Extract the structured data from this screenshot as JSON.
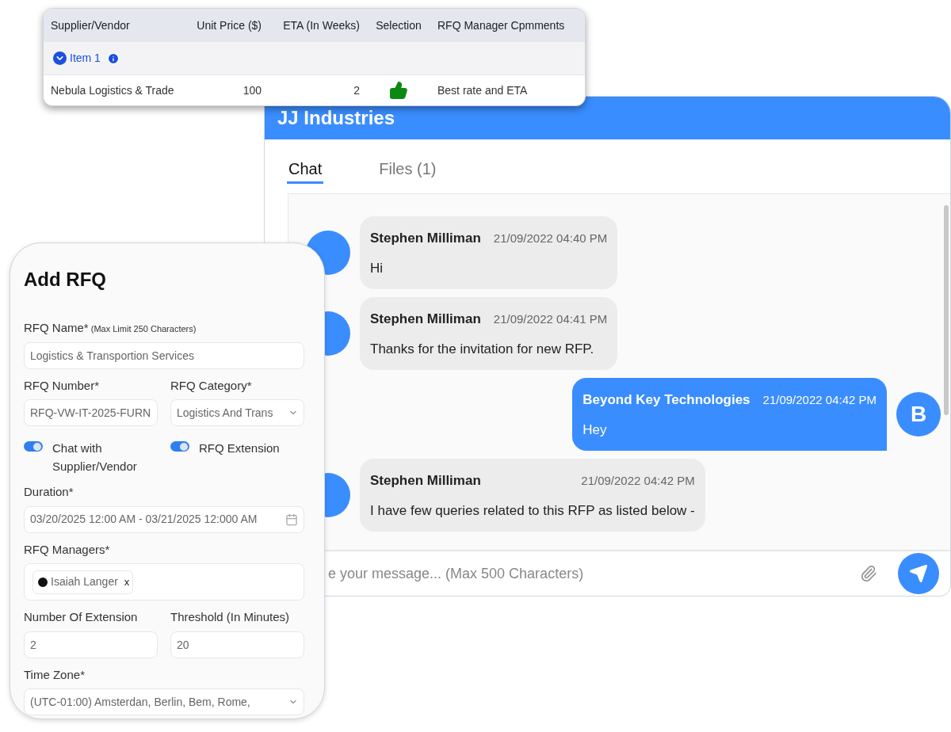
{
  "rfq_table": {
    "columns": [
      "Supplier/Vendor",
      "Unit Price ($)",
      "ETA (In Weeks)",
      "Selection",
      "RFQ Manager Cpmments"
    ],
    "groups": [
      {
        "label": "Item 1",
        "expanded": true,
        "rows": [
          {
            "supplier": "Nebula Logistics & Trade",
            "unit_price": "100",
            "eta": "2",
            "selected": true,
            "comment": "Best rate and ETA"
          }
        ]
      }
    ]
  },
  "chat": {
    "title": "JJ Industries",
    "tabs": [
      {
        "label": "Chat",
        "selected": true
      },
      {
        "label": "Files (1)",
        "selected": false
      }
    ],
    "messages": [
      {
        "sender": "Stephen Milliman",
        "time": "21/09/2022 04:40 PM",
        "text": "Hi",
        "own": false
      },
      {
        "sender": "Stephen Milliman",
        "time": "21/09/2022 04:41 PM",
        "text": "Thanks for the invitation for new RFP.",
        "own": false
      },
      {
        "sender": "Beyond Key Technologies",
        "time": "21/09/2022 04:42 PM",
        "text": "Hey",
        "avatar": "B",
        "own": true
      },
      {
        "sender": "Stephen Milliman",
        "time": "21/09/2022 04:42 PM",
        "text": "I have few queries related to this RFP as listed below -",
        "own": false
      }
    ],
    "composer": {
      "placeholder": "e your message... (Max 500 Characters)"
    }
  },
  "add_rfq": {
    "title": "Add RFQ",
    "rows": [
      [
        {
          "kind": "text",
          "label": "RFQ Name*",
          "hint": "(Max Limit 250 Characters)",
          "value": "Logistics & Transportion Services"
        }
      ],
      [
        {
          "kind": "text",
          "label": "RFQ Number*",
          "value": "RFQ-VW-IT-2025-FURN"
        },
        {
          "kind": "select",
          "label": "RFQ Category*",
          "value": "Logistics And Trans"
        }
      ],
      [
        {
          "kind": "toggle",
          "label": "Chat with Supplier/Vendor",
          "on": true
        },
        {
          "kind": "toggle",
          "label": "RFQ Extension",
          "on": true
        }
      ],
      [
        {
          "kind": "date",
          "label": "Duration*",
          "value": "03/20/2025 12:00 AM - 03/21/2025 12:000 AM"
        }
      ],
      [
        {
          "kind": "tags",
          "label": "RFQ Managers*",
          "tags": [
            "Isaiah Langer"
          ],
          "remove": "x"
        }
      ],
      [
        {
          "kind": "text",
          "label": "Number Of Extension",
          "value": "2"
        },
        {
          "kind": "text",
          "label": "Threshold (In Minutes)",
          "value": "20"
        }
      ],
      [
        {
          "kind": "select",
          "label": "Time Zone*",
          "value": "(UTC-01:00) Amsterdan, Berlin, Bem, Rome,"
        }
      ]
    ]
  }
}
